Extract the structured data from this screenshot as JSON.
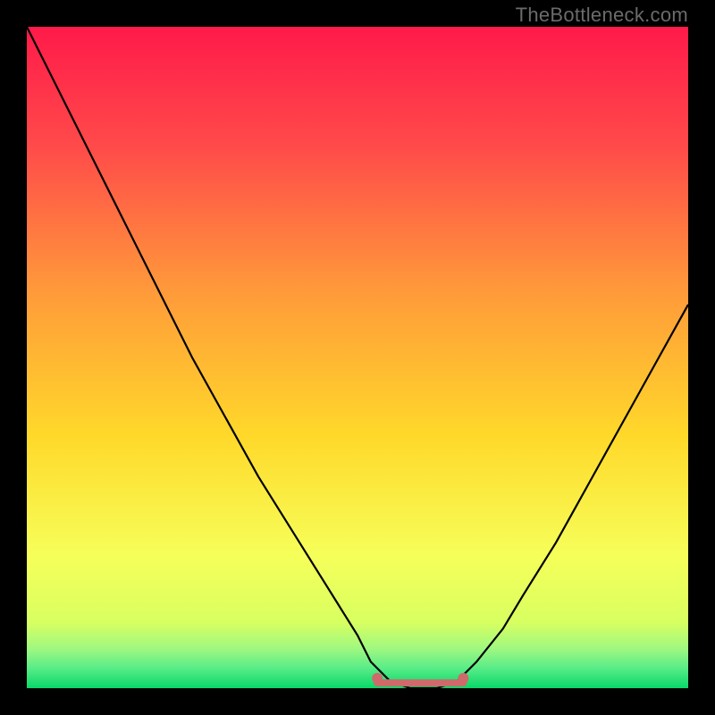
{
  "watermark": "TheBottleneck.com",
  "colors": {
    "frame": "#000000",
    "curve": "#000000",
    "highlight": "#cf6a6a",
    "gradient": {
      "top": "#ff1a4a",
      "mid1": "#ff7a3a",
      "mid2": "#ffd92a",
      "low": "#f6ff5a",
      "green": "#00e060"
    }
  },
  "chart_data": {
    "type": "line",
    "title": "",
    "xlabel": "",
    "ylabel": "",
    "xlim": [
      0,
      100
    ],
    "ylim": [
      0,
      100
    ],
    "x": [
      0,
      5,
      10,
      15,
      20,
      25,
      30,
      35,
      40,
      45,
      50,
      52,
      55,
      58,
      62,
      65,
      68,
      72,
      75,
      80,
      85,
      90,
      95,
      100
    ],
    "y": [
      100,
      90,
      80,
      70,
      60,
      50,
      41,
      32,
      24,
      16,
      8,
      4,
      1,
      0,
      0,
      1,
      4,
      9,
      14,
      22,
      31,
      40,
      49,
      58
    ],
    "flat_segment": {
      "x_start": 53,
      "x_end": 66,
      "y": 0.8
    },
    "flat_markers": [
      {
        "x": 53,
        "y": 1.5
      },
      {
        "x": 66,
        "y": 1.5
      }
    ]
  }
}
